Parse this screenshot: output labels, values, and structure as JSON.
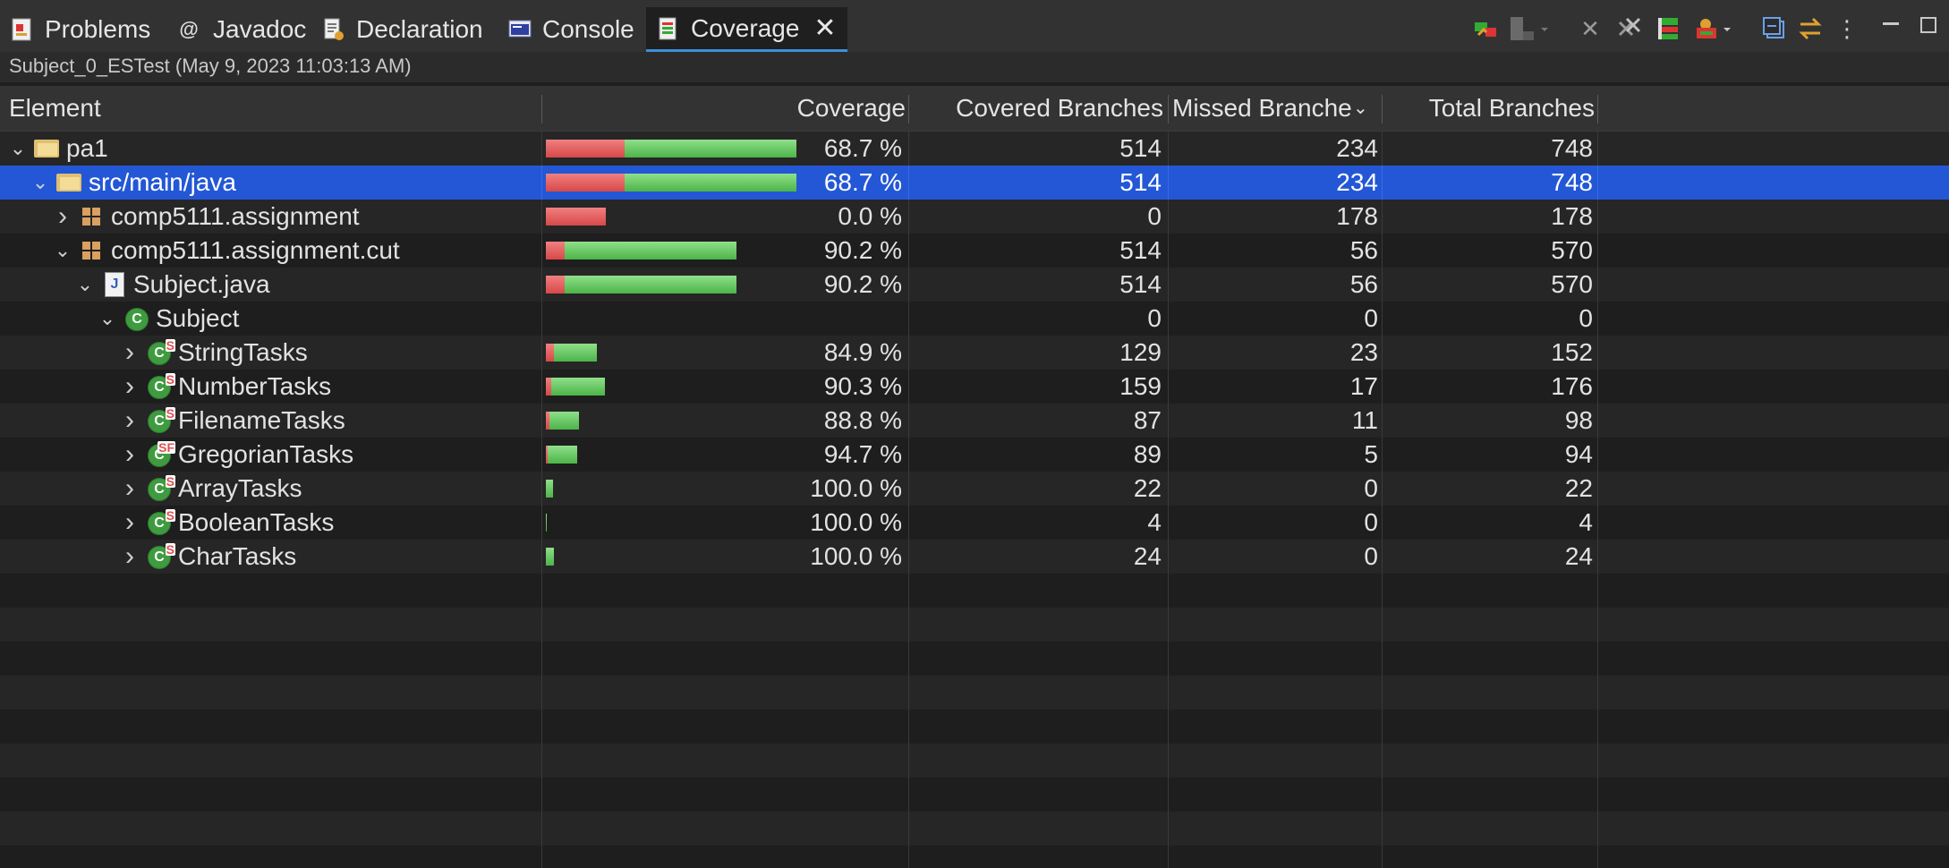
{
  "tabs": [
    {
      "label": "Problems",
      "icon": "problems-icon"
    },
    {
      "label": "Javadoc",
      "icon": "javadoc-icon"
    },
    {
      "label": "Declaration",
      "icon": "declaration-icon"
    },
    {
      "label": "Console",
      "icon": "console-icon"
    },
    {
      "label": "Coverage",
      "icon": "coverage-icon",
      "active": true
    }
  ],
  "toolbar": {
    "icons": [
      "relaunch-icon",
      "dump-execution-data-icon",
      "remove-session-icon",
      "remove-all-sessions-icon",
      "merge-sessions-icon",
      "select-session-icon",
      "collapse-all-icon",
      "link-with-editor-icon",
      "view-menu-icon",
      "minimize-icon",
      "maximize-icon"
    ]
  },
  "session": {
    "title": "Subject_0_ESTest (May 9, 2023 11:03:13 AM)"
  },
  "columns": {
    "element": "Element",
    "coverage": "Coverage",
    "covered": "Covered Branches",
    "missed": "Missed Branche",
    "total": "Total Branches"
  },
  "colors": {
    "selection": "#2357d6",
    "covered": "#5cc458",
    "missed": "#e05858",
    "active_tab_underline": "#3f8fd8"
  },
  "rows": [
    {
      "name": "pa1",
      "icon": "project-icon",
      "indent": 0,
      "expander": "expanded",
      "coverage": "68.7 %",
      "covered": "514",
      "missed": "234",
      "total": "748",
      "bar_missed": 234,
      "bar_covered": 514
    },
    {
      "name": "src/main/java",
      "icon": "source-folder-icon",
      "indent": 1,
      "expander": "expanded",
      "selected": true,
      "coverage": "68.7 %",
      "covered": "514",
      "missed": "234",
      "total": "748",
      "bar_missed": 234,
      "bar_covered": 514
    },
    {
      "name": "comp5111.assignment",
      "icon": "package-icon",
      "indent": 2,
      "expander": "collapsed",
      "coverage": "0.0 %",
      "covered": "0",
      "missed": "178",
      "total": "178",
      "bar_missed": 178,
      "bar_covered": 0
    },
    {
      "name": "comp5111.assignment.cut",
      "icon": "package-icon",
      "indent": 2,
      "expander": "expanded",
      "coverage": "90.2 %",
      "covered": "514",
      "missed": "56",
      "total": "570",
      "bar_missed": 56,
      "bar_covered": 514
    },
    {
      "name": "Subject.java",
      "icon": "java-file-icon",
      "indent": 3,
      "expander": "expanded",
      "coverage": "90.2 %",
      "covered": "514",
      "missed": "56",
      "total": "570",
      "bar_missed": 56,
      "bar_covered": 514
    },
    {
      "name": "Subject",
      "icon": "class-icon",
      "indent": 4,
      "expander": "expanded",
      "coverage": "",
      "covered": "0",
      "missed": "0",
      "total": "0",
      "bar_missed": 0,
      "bar_covered": 0
    },
    {
      "name": "StringTasks",
      "icon": "static-class-icon",
      "indent": 5,
      "expander": "collapsed",
      "coverage": "84.9 %",
      "covered": "129",
      "missed": "23",
      "total": "152",
      "bar_missed": 23,
      "bar_covered": 129
    },
    {
      "name": "NumberTasks",
      "icon": "static-class-icon",
      "indent": 5,
      "expander": "collapsed",
      "coverage": "90.3 %",
      "covered": "159",
      "missed": "17",
      "total": "176",
      "bar_missed": 17,
      "bar_covered": 159
    },
    {
      "name": "FilenameTasks",
      "icon": "static-class-icon",
      "indent": 5,
      "expander": "collapsed",
      "coverage": "88.8 %",
      "covered": "87",
      "missed": "11",
      "total": "98",
      "bar_missed": 11,
      "bar_covered": 87
    },
    {
      "name": "GregorianTasks",
      "icon": "static-final-class-icon",
      "indent": 5,
      "expander": "collapsed",
      "coverage": "94.7 %",
      "covered": "89",
      "missed": "5",
      "total": "94",
      "bar_missed": 5,
      "bar_covered": 89
    },
    {
      "name": "ArrayTasks",
      "icon": "static-class-icon",
      "indent": 5,
      "expander": "collapsed",
      "coverage": "100.0 %",
      "covered": "22",
      "missed": "0",
      "total": "22",
      "bar_missed": 0,
      "bar_covered": 22
    },
    {
      "name": "BooleanTasks",
      "icon": "static-class-icon",
      "indent": 5,
      "expander": "collapsed",
      "coverage": "100.0 %",
      "covered": "4",
      "missed": "0",
      "total": "4",
      "bar_missed": 0,
      "bar_covered": 4
    },
    {
      "name": "CharTasks",
      "icon": "static-class-icon",
      "indent": 5,
      "expander": "collapsed",
      "coverage": "100.0 %",
      "covered": "24",
      "missed": "0",
      "total": "24",
      "bar_missed": 0,
      "bar_covered": 24
    }
  ]
}
